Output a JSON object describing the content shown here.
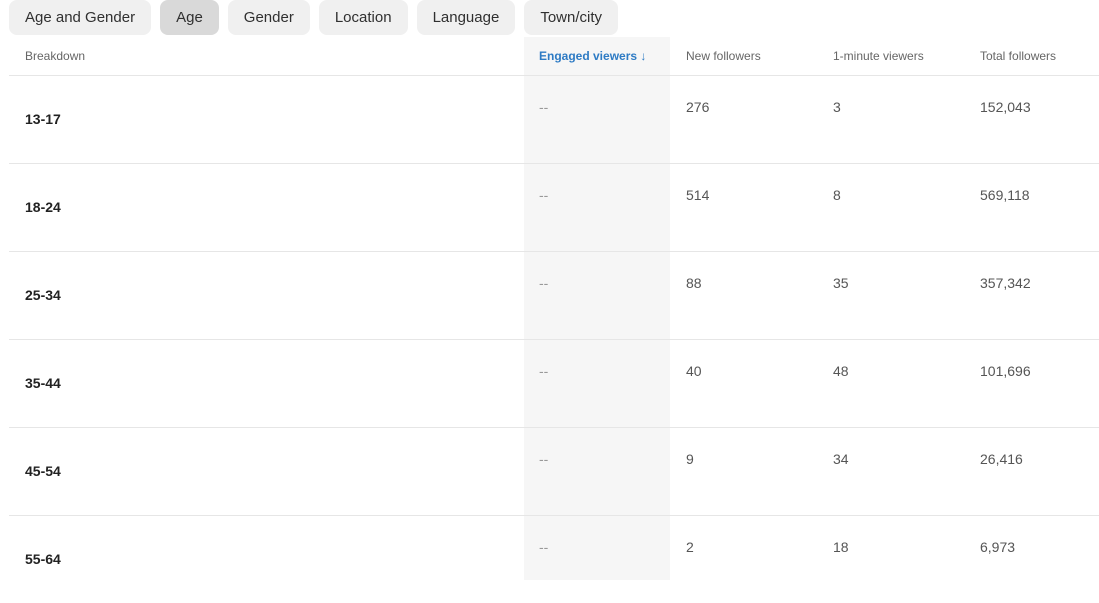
{
  "tabs": [
    {
      "label": "Age and Gender",
      "active": false
    },
    {
      "label": "Age",
      "active": true
    },
    {
      "label": "Gender",
      "active": false
    },
    {
      "label": "Location",
      "active": false
    },
    {
      "label": "Language",
      "active": false
    },
    {
      "label": "Town/city",
      "active": false
    }
  ],
  "table": {
    "headers": {
      "breakdown": "Breakdown",
      "engaged": "Engaged viewers",
      "sort_arrow": "↓",
      "new_followers": "New followers",
      "one_minute": "1-minute viewers",
      "total_followers": "Total followers"
    },
    "rows": [
      {
        "label": "13-17",
        "engaged": "--",
        "new_followers": "276",
        "one_minute": "3",
        "total_followers": "152,043"
      },
      {
        "label": "18-24",
        "engaged": "--",
        "new_followers": "514",
        "one_minute": "8",
        "total_followers": "569,118"
      },
      {
        "label": "25-34",
        "engaged": "--",
        "new_followers": "88",
        "one_minute": "35",
        "total_followers": "357,342"
      },
      {
        "label": "35-44",
        "engaged": "--",
        "new_followers": "40",
        "one_minute": "48",
        "total_followers": "101,696"
      },
      {
        "label": "45-54",
        "engaged": "--",
        "new_followers": "9",
        "one_minute": "34",
        "total_followers": "26,416"
      },
      {
        "label": "55-64",
        "engaged": "--",
        "new_followers": "2",
        "one_minute": "18",
        "total_followers": "6,973"
      }
    ]
  },
  "colors": {
    "accent": "#2e7bc4",
    "tab_bg": "#f0f0f0",
    "tab_active_bg": "#d9d9d9"
  }
}
